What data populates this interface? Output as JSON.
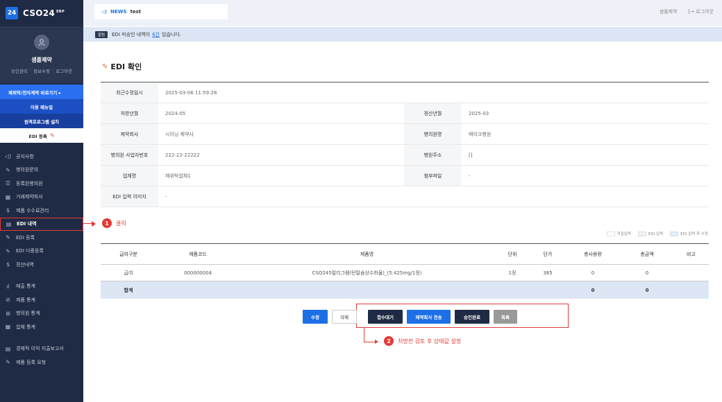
{
  "sidebar": {
    "logo_box": "24",
    "logo_text": "CSO24",
    "logo_sup": "ERP",
    "profile_name": "샘플제약",
    "profile_links": [
      "승인관리",
      "정보수정",
      "로그아웃"
    ],
    "quick_link": "제위탁/전자계약 바로가기 ▸",
    "manual_btn": "이용 매뉴얼",
    "remote_btn": "원격프로그램 설치",
    "edi_reg_btn": "EDI 등록",
    "menu": [
      {
        "label": "공지사항",
        "icon": "◁)"
      },
      {
        "label": "병의원문의",
        "icon": "✎"
      },
      {
        "label": "등록된병의원",
        "icon": "☰"
      },
      {
        "label": "거래제약회사",
        "icon": "▦"
      },
      {
        "label": "제품 수수료관리",
        "icon": "$"
      },
      {
        "label": "EDI 내역",
        "icon": "▤"
      },
      {
        "label": "EDI 등록",
        "icon": "✎"
      },
      {
        "label": "EDI 다중등록",
        "icon": "✎"
      },
      {
        "label": "정산내역",
        "icon": "$"
      }
    ],
    "menu2": [
      {
        "label": "매출 통계",
        "icon": "ıl"
      },
      {
        "label": "제품 통계",
        "icon": "⊘"
      },
      {
        "label": "병의원 통계",
        "icon": "⊞"
      },
      {
        "label": "업체 통계",
        "icon": "▦"
      }
    ],
    "menu3": [
      {
        "label": "경제적 이익 지출보고서",
        "icon": "▤"
      },
      {
        "label": "제품 등록 요청",
        "icon": "✎"
      }
    ]
  },
  "topbar": {
    "news_label": "NEWS",
    "news_text": "test",
    "company": "샘플제약",
    "logout": "[→ 로그아웃"
  },
  "notice": {
    "badge": "알림",
    "prefix": "EDI 미승인 내역이",
    "count": "6건",
    "suffix": "있습니다."
  },
  "page": {
    "title": "EDI 확인"
  },
  "info": {
    "recent_label": "최근수정일시",
    "recent_value": "2025-03-06 11:59:28",
    "prescribe_label": "처방년월",
    "prescribe_value": "2024-05",
    "settle_label": "정산년월",
    "settle_value": "2025-03",
    "pharma_label": "제약회사",
    "pharma_value": "시이닝 제약사",
    "hospital_label": "병의원명",
    "hospital_value": "메이크병원",
    "bizno_label": "병의원 사업자번호",
    "bizno_value": "222-22-22222",
    "address_label": "병원주소",
    "address_value": "[]",
    "vendor_label": "업체명",
    "vendor_value": "제위탁업체1",
    "attach_label": "첨부파일",
    "attach_value": "-",
    "image_label": "EDI 입력 이미지",
    "image_value": "-"
  },
  "legend": [
    "직접입력",
    "EDI 입력",
    "EDI 입력 후 수정"
  ],
  "products": {
    "headers": [
      "급여구분",
      "제품코드",
      "제품명",
      "단위",
      "단가",
      "총사용량",
      "총금액",
      "비고"
    ],
    "row": [
      "급여",
      "000000004",
      "CSO245멀리그램(탄탈솜상수화물)_(5.425mg/1정)",
      "1정",
      "385",
      "0",
      "0",
      ""
    ],
    "total": [
      "합계",
      "",
      "",
      "",
      "",
      "0",
      "0",
      ""
    ]
  },
  "buttons": {
    "edit": "수정",
    "delete": "삭제",
    "wait": "접수대기",
    "send": "제약회사 전송",
    "done": "승인완료",
    "list": "목록"
  },
  "annotations": {
    "one_num": "1",
    "one_text": "클릭",
    "two_num": "2",
    "two_text": "처방전 검토 후 상태값 설정"
  },
  "colors": {
    "sidebar": "#1f2a44",
    "accent": "#1d6fe5",
    "annotation": "#e53935"
  }
}
